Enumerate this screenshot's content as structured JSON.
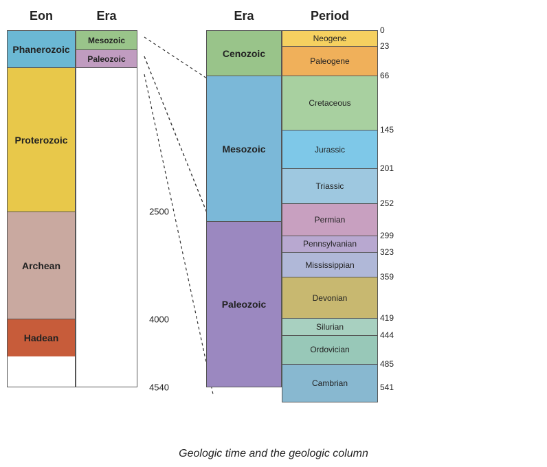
{
  "title": "Geologic time and the geologic column",
  "leftChart": {
    "eonHeader": "Eon",
    "eraHeader": "Era",
    "eons": [
      {
        "name": "Phanerozoic",
        "colorClass": "color-phanerozoic",
        "heightPct": 10.4
      },
      {
        "name": "Proterozoic",
        "colorClass": "color-proterozoic",
        "heightPct": 40.4
      },
      {
        "name": "Archean",
        "colorClass": "color-archean",
        "heightPct": 30.0
      },
      {
        "name": "Hadean",
        "colorClass": "color-hadean",
        "heightPct": 10.4
      }
    ],
    "erasLeft": [
      {
        "name": "Mesozoic",
        "colorClass": "color-mesozoic-left",
        "heightPct": 5.4
      },
      {
        "name": "Paleozoic",
        "colorClass": "color-paleozoic-left",
        "heightPct": 5.0
      },
      {
        "name": "",
        "colorClass": "color-empty",
        "heightPct": 89.6
      }
    ],
    "numbers": [
      {
        "value": "2500",
        "pct": 50.8
      },
      {
        "value": "4000",
        "pct": 81.0
      },
      {
        "value": "4540",
        "pct": 100
      }
    ]
  },
  "rightChart": {
    "eraHeader": "Era",
    "periodHeader": "Period",
    "eras": [
      {
        "name": "Cenozoic",
        "colorClass": "color-cenozoic",
        "heightPct": 12.7
      },
      {
        "name": "Mesozoic",
        "colorClass": "color-mesozoic",
        "heightPct": 40.8
      },
      {
        "name": "Paleozoic",
        "colorClass": "color-paleozoic",
        "heightPct": 46.5
      }
    ],
    "periods": [
      {
        "name": "Neogene",
        "colorClass": "color-neogene",
        "heightPct": 4.4
      },
      {
        "name": "Paleogene",
        "colorClass": "color-paleogene",
        "heightPct": 8.3
      },
      {
        "name": "Cretaceous",
        "colorClass": "color-cretaceous",
        "heightPct": 15.2
      },
      {
        "name": "Jurassic",
        "colorClass": "color-jurassic",
        "heightPct": 10.8
      },
      {
        "name": "Triassic",
        "colorClass": "color-triassic",
        "heightPct": 9.8
      },
      {
        "name": "Permian",
        "colorClass": "color-permian",
        "heightPct": 9.0
      },
      {
        "name": "Pennsylvanian",
        "colorClass": "color-pennsylvanian",
        "heightPct": 4.6
      },
      {
        "name": "Mississippian",
        "colorClass": "color-mississippian",
        "heightPct": 7.0
      },
      {
        "name": "Devonian",
        "colorClass": "color-devonian",
        "heightPct": 11.5
      },
      {
        "name": "Silurian",
        "colorClass": "color-silurian",
        "heightPct": 4.8
      },
      {
        "name": "Ordovician",
        "colorClass": "color-ordovician",
        "heightPct": 8.0
      },
      {
        "name": "Cambrian",
        "colorClass": "color-cambrian",
        "heightPct": 10.8
      }
    ],
    "numbers": [
      {
        "value": "0",
        "pct": 0
      },
      {
        "value": "23",
        "pct": 4.4
      },
      {
        "value": "66",
        "pct": 12.7
      },
      {
        "value": "145",
        "pct": 27.9
      },
      {
        "value": "201",
        "pct": 38.7
      },
      {
        "value": "252",
        "pct": 48.5
      },
      {
        "value": "299",
        "pct": 57.5
      },
      {
        "value": "323",
        "pct": 62.1
      },
      {
        "value": "359",
        "pct": 69.1
      },
      {
        "value": "419",
        "pct": 80.6
      },
      {
        "value": "444",
        "pct": 85.4
      },
      {
        "value": "485",
        "pct": 93.4
      },
      {
        "value": "541",
        "pct": 100
      }
    ]
  }
}
